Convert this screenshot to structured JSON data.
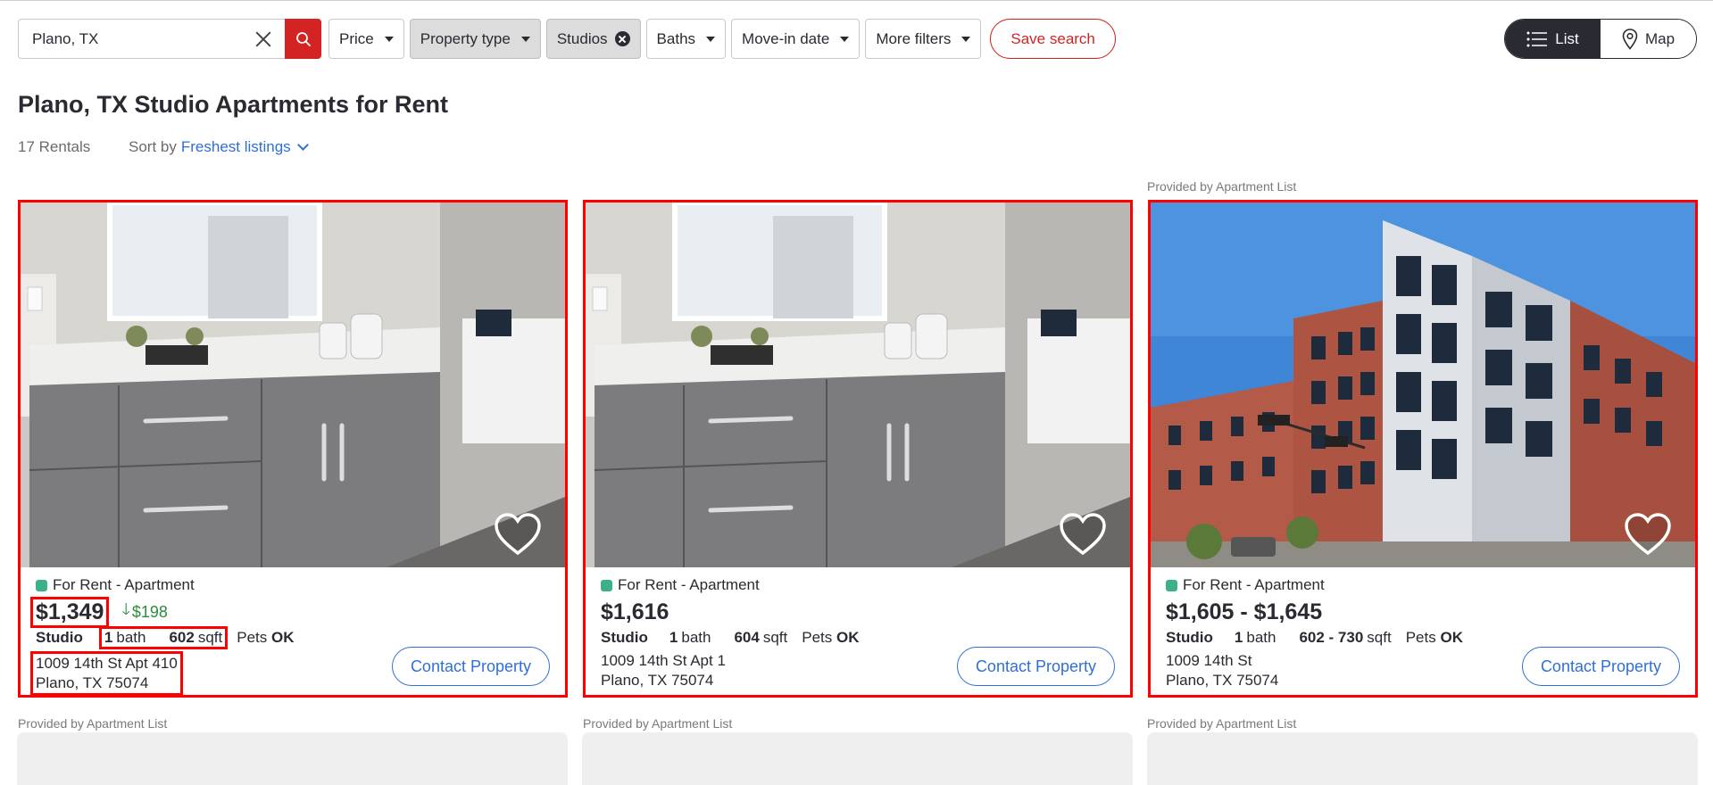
{
  "search": {
    "value": "Plano, TX"
  },
  "filters": {
    "price": "Price",
    "property_type": "Property type",
    "studios": "Studios",
    "baths": "Baths",
    "move_in": "Move-in date",
    "more": "More filters",
    "save": "Save search"
  },
  "view_toggle": {
    "list": "List",
    "map": "Map",
    "selected": "List"
  },
  "page_title": "Plano, TX Studio Apartments for Rent",
  "results_count": "17 Rentals",
  "sort": {
    "label": "Sort by",
    "value": "Freshest listings"
  },
  "provided_by": "Provided by Apartment List",
  "colors": {
    "accent_red": "#d32323",
    "link_blue": "#2f6fd6",
    "status_green": "#3cb08a",
    "price_drop_green": "#2c8c3a",
    "highlight_box": "#ff0000"
  },
  "listings": [
    {
      "status": "For Rent - Apartment",
      "price": "$1,349",
      "price_drop": "$198",
      "beds": "Studio",
      "baths_num": "1",
      "baths_unit": "bath",
      "sqft_num": "602",
      "sqft_unit": "sqft",
      "pets_label": "Pets",
      "pets_value": "OK",
      "address_line1": "1009 14th St Apt 410",
      "address_line2": "Plano, TX 75074",
      "contact": "Contact Property",
      "photo": "bathroom-vanity"
    },
    {
      "status": "For Rent - Apartment",
      "price": "$1,616",
      "beds": "Studio",
      "baths_num": "1",
      "baths_unit": "bath",
      "sqft_num": "604",
      "sqft_unit": "sqft",
      "pets_label": "Pets",
      "pets_value": "OK",
      "address_line1": "1009 14th St Apt 1",
      "address_line2": "Plano, TX 75074",
      "contact": "Contact Property",
      "photo": "bathroom-vanity"
    },
    {
      "status": "For Rent - Apartment",
      "price": "$1,605 - $1,645",
      "beds": "Studio",
      "baths_num": "1",
      "baths_unit": "bath",
      "sqft_num": "602 - 730",
      "sqft_unit": "sqft",
      "pets_label": "Pets",
      "pets_value": "OK",
      "address_line1": "1009 14th St",
      "address_line2": "Plano, TX 75074",
      "contact": "Contact Property",
      "photo": "brick-apartment-building"
    }
  ]
}
